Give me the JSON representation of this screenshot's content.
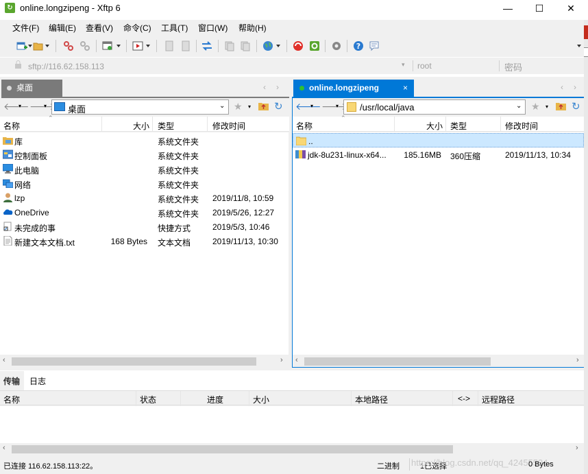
{
  "window": {
    "title": "online.longzipeng - Xftp 6",
    "minimize": "—",
    "maximize": "☐",
    "close": "✕",
    "app_icon": "xftp-app-icon"
  },
  "menu": [
    "文件(F)",
    "编辑(E)",
    "查看(V)",
    "命令(C)",
    "工具(T)",
    "窗口(W)",
    "帮助(H)"
  ],
  "toolbar": {
    "icons": [
      "new-session-icon",
      "open-folder-icon",
      "disconnect-icon",
      "reconnect-icon",
      "new-window-icon",
      "terminal-icon",
      "copy-icon",
      "paste-icon",
      "transfer-icon",
      "delete-icon",
      "rename-icon",
      "globe-icon",
      "xshell-icon",
      "xftp-icon",
      "settings-icon",
      "help-icon",
      "feedback-icon"
    ]
  },
  "address": {
    "url": "sftp://116.62.158.113",
    "user": "root",
    "password_placeholder": "密码"
  },
  "left": {
    "tab": "桌面",
    "path": "桌面",
    "columns": [
      "名称",
      "大小",
      "类型",
      "修改时间"
    ],
    "files": [
      {
        "icon": "library-icon",
        "name": "库",
        "size": "",
        "type": "系统文件夹",
        "date": ""
      },
      {
        "icon": "control-panel-icon",
        "name": "控制面板",
        "size": "",
        "type": "系统文件夹",
        "date": ""
      },
      {
        "icon": "computer-icon",
        "name": "此电脑",
        "size": "",
        "type": "系统文件夹",
        "date": ""
      },
      {
        "icon": "network-icon",
        "name": "网络",
        "size": "",
        "type": "系统文件夹",
        "date": ""
      },
      {
        "icon": "user-icon",
        "name": "lzp",
        "size": "",
        "type": "系统文件夹",
        "date": "2019/11/8, 10:59"
      },
      {
        "icon": "onedrive-icon",
        "name": "OneDrive",
        "size": "",
        "type": "系统文件夹",
        "date": "2019/5/26, 12:27"
      },
      {
        "icon": "shortcut-icon",
        "name": "未完成的事",
        "size": "",
        "type": "快捷方式",
        "date": "2019/5/3, 10:46"
      },
      {
        "icon": "text-file-icon",
        "name": "新建文本文档.txt",
        "size": "168 Bytes",
        "type": "文本文档",
        "date": "2019/11/13, 10:30"
      }
    ]
  },
  "right": {
    "tab": "online.longzipeng",
    "tab_close": "×",
    "path": "/usr/local/java",
    "columns": [
      "名称",
      "大小",
      "类型",
      "修改时间"
    ],
    "files": [
      {
        "icon": "folder-icon",
        "name": "..",
        "size": "",
        "type": "",
        "date": ""
      },
      {
        "icon": "archive-icon",
        "name": "jdk-8u231-linux-x64...",
        "size": "185.16MB",
        "type": "360压缩",
        "date": "2019/11/13, 10:34"
      }
    ]
  },
  "transfer": {
    "tabs": [
      "传输",
      "日志"
    ],
    "columns": [
      "名称",
      "状态",
      "进度",
      "大小",
      "本地路径",
      "<->",
      "远程路径"
    ]
  },
  "status": {
    "connection": "已连接 116.62.158.113:22。",
    "mode": "二进制",
    "selected": "1已选择",
    "size": "0 Bytes",
    "watermark": "https://blog.csdn.net/qq_42455534"
  },
  "colors": {
    "active_tab": "#0078d7",
    "selection": "#cce8ff",
    "folder": "#f8d775"
  }
}
